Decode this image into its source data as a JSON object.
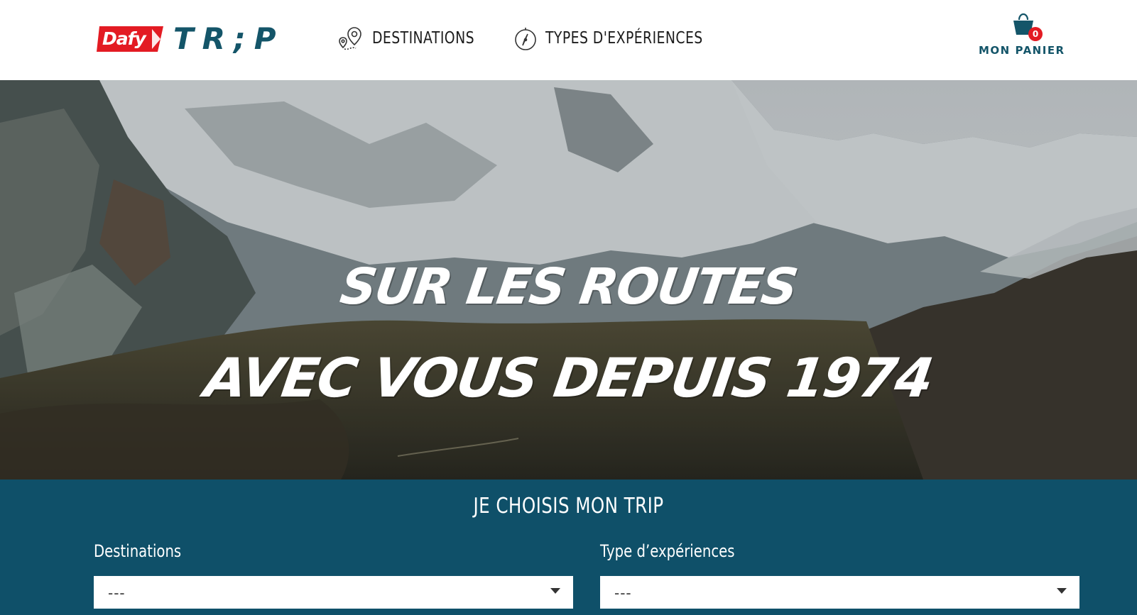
{
  "brand": {
    "badge_text": "Dafy",
    "name": "TR;P",
    "badge_color": "#e31b23",
    "name_color": "#145569"
  },
  "nav": {
    "items": [
      {
        "label": "DESTINATIONS",
        "icon": "map-pin-icon"
      },
      {
        "label": "TYPES D'EXPÉRIENCES",
        "icon": "compass-icon"
      }
    ]
  },
  "cart": {
    "label": "MON PANIER",
    "count": "0",
    "icon": "shopping-bag-icon"
  },
  "hero": {
    "line1": "SUR LES ROUTES",
    "line2": "AVEC VOUS DEPUIS 1974"
  },
  "selector": {
    "title": "JE CHOISIS MON TRIP",
    "background": "#0f5069",
    "destinations": {
      "label": "Destinations",
      "value": "---"
    },
    "experiences": {
      "label": "Type d’expériences",
      "value": "---"
    }
  }
}
